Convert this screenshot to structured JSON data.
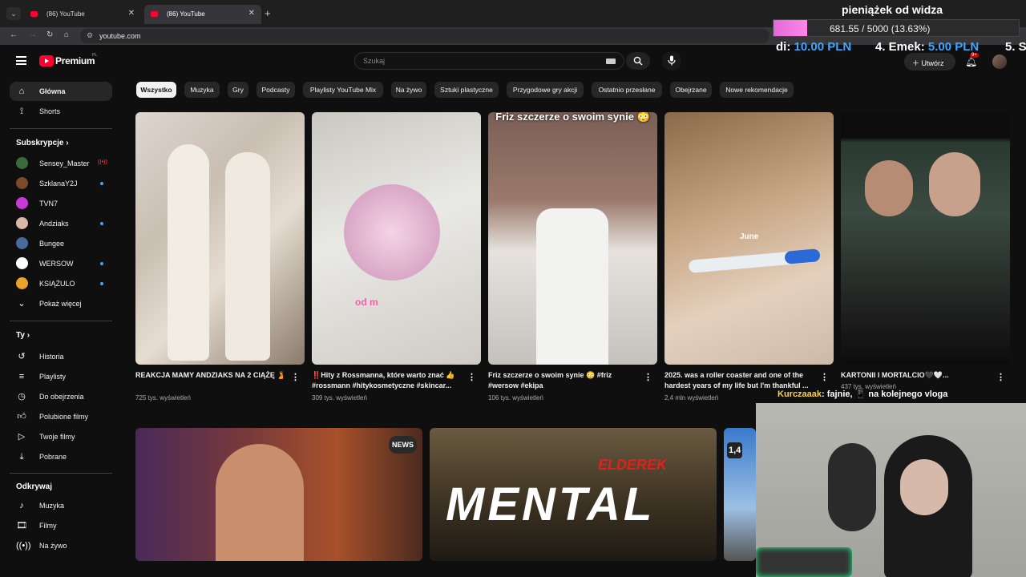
{
  "browser": {
    "tabs": [
      {
        "title": "(86) YouTube"
      },
      {
        "title": "(86) YouTube"
      }
    ],
    "url": "youtube.com"
  },
  "header": {
    "logo_text": "Premium",
    "logo_region": "PL",
    "search_placeholder": "Szukaj",
    "create_label": "Utwórz",
    "notifications_badge": "9+"
  },
  "sidebar": {
    "top": [
      {
        "label": "Główna",
        "icon": "home-icon"
      },
      {
        "label": "Shorts",
        "icon": "shorts-icon"
      }
    ],
    "subscriptions_header": "Subskrypcje",
    "subscriptions": [
      {
        "label": "Sensey_Master",
        "status": "live"
      },
      {
        "label": "SzklanaY2J",
        "status": "new"
      },
      {
        "label": "TVN7",
        "status": ""
      },
      {
        "label": "Andziaks",
        "status": "new"
      },
      {
        "label": "Bungee",
        "status": ""
      },
      {
        "label": "WERSOW",
        "status": "new"
      },
      {
        "label": "KSIĄŻULO",
        "status": "new"
      }
    ],
    "show_more": "Pokaż więcej",
    "you_header": "Ty",
    "you": [
      {
        "label": "Historia",
        "icon": "history-icon"
      },
      {
        "label": "Playlisty",
        "icon": "playlist-icon"
      },
      {
        "label": "Do obejrzenia",
        "icon": "watch-later-icon"
      },
      {
        "label": "Polubione filmy",
        "icon": "like-icon"
      },
      {
        "label": "Twoje filmy",
        "icon": "your-videos-icon"
      },
      {
        "label": "Pobrane",
        "icon": "download-icon"
      }
    ],
    "explore_header": "Odkrywaj",
    "explore": [
      {
        "label": "Muzyka",
        "icon": "music-icon"
      },
      {
        "label": "Filmy",
        "icon": "movies-icon"
      },
      {
        "label": "Na żywo",
        "icon": "live-icon"
      }
    ]
  },
  "chips": [
    "Wszystko",
    "Muzyka",
    "Gry",
    "Podcasty",
    "Playlisty YouTube Mix",
    "Na żywo",
    "Sztuki plastyczne",
    "Przygodowe gry akcji",
    "Ostatnio przesłane",
    "Obejrzane",
    "Nowe rekomendacje"
  ],
  "videos": [
    {
      "title": "REAKCJA MAMY ANDZIAKS NA 2 CIĄŻĘ 🫄",
      "meta": "725 tys. wyświetleń"
    },
    {
      "title": "‼️Hity z Rossmanna, które warto znać 👍 #rossmann #hitykosmetyczne #skincar...",
      "meta": "309 tys. wyświetleń"
    },
    {
      "title": "Friz szczerze o swoim synie 😳 #friz #wersow #ekipa",
      "meta": "106 tys. wyświetleń"
    },
    {
      "title": "2025. was a roller coaster and one of the hardest years of my life but I'm thankful ...",
      "meta": "2,4 mln wyświetleń"
    },
    {
      "title": "KARTONII I MORTALCIO🖤🤍...",
      "meta": "437 tys. wyświetleń"
    }
  ],
  "thumb_captions": {
    "v2": "od m",
    "v3": "Friz szczerze o swoim synie 😳",
    "v4": "June",
    "big2": "MENTAL",
    "big2_top": "ELDEREK",
    "big1_badge": "NEWS",
    "big3_badge": "1,4"
  },
  "overlay": {
    "donation_title": "pieniążek od widza",
    "donation_progress": "681.55 / 5000 (13.63%)",
    "donation_fraction": 0.1363,
    "ticker": [
      {
        "prefix": "di: ",
        "amount": "10.00 PLN"
      },
      {
        "prefix": "4. Emek: ",
        "amount": "5.00 PLN"
      },
      {
        "prefix": "5. S",
        "amount": ""
      }
    ],
    "chat_user": "Kurczaaak",
    "chat_message": ": fajnie, 📱 na kolejnego vloga"
  }
}
